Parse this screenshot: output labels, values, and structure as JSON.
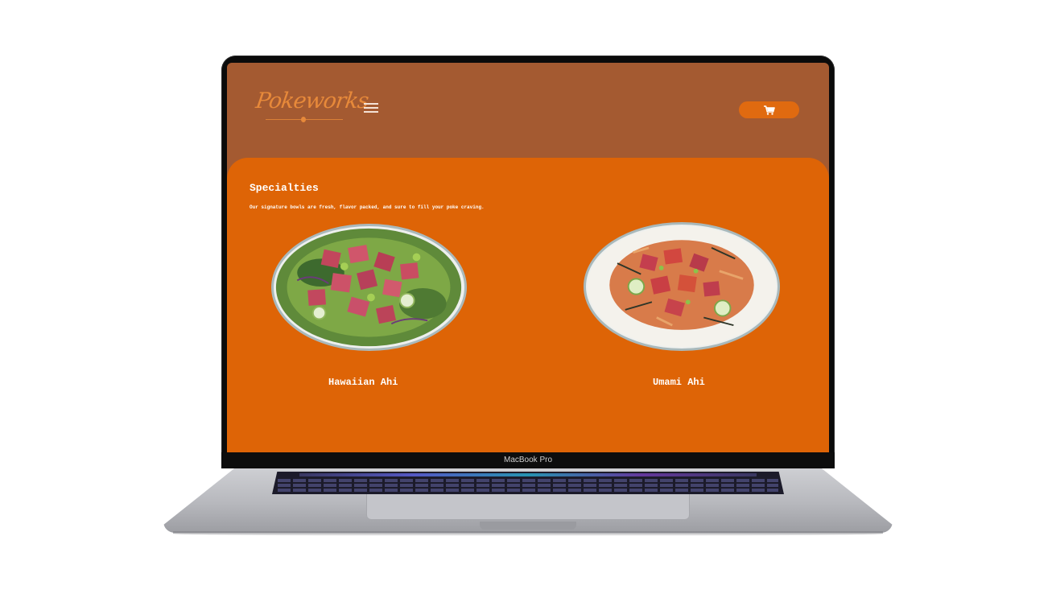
{
  "device": {
    "model_label": "MacBook Pro"
  },
  "site": {
    "logo_text": "Pokeworks",
    "menu_icon": "hamburger-menu-icon",
    "cart_icon": "shopping-cart-icon",
    "colors": {
      "header_bg": "#a45a31",
      "content_bg": "#de6406",
      "accent": "#e06a10",
      "text": "#ffffff"
    }
  },
  "specialties": {
    "heading": "Specialties",
    "description": "Our signature bowls are fresh, flavor packed, and sure to fill your poke craving.",
    "items": [
      {
        "name": "Hawaiian Ahi"
      },
      {
        "name": "Umami Ahi"
      }
    ]
  }
}
